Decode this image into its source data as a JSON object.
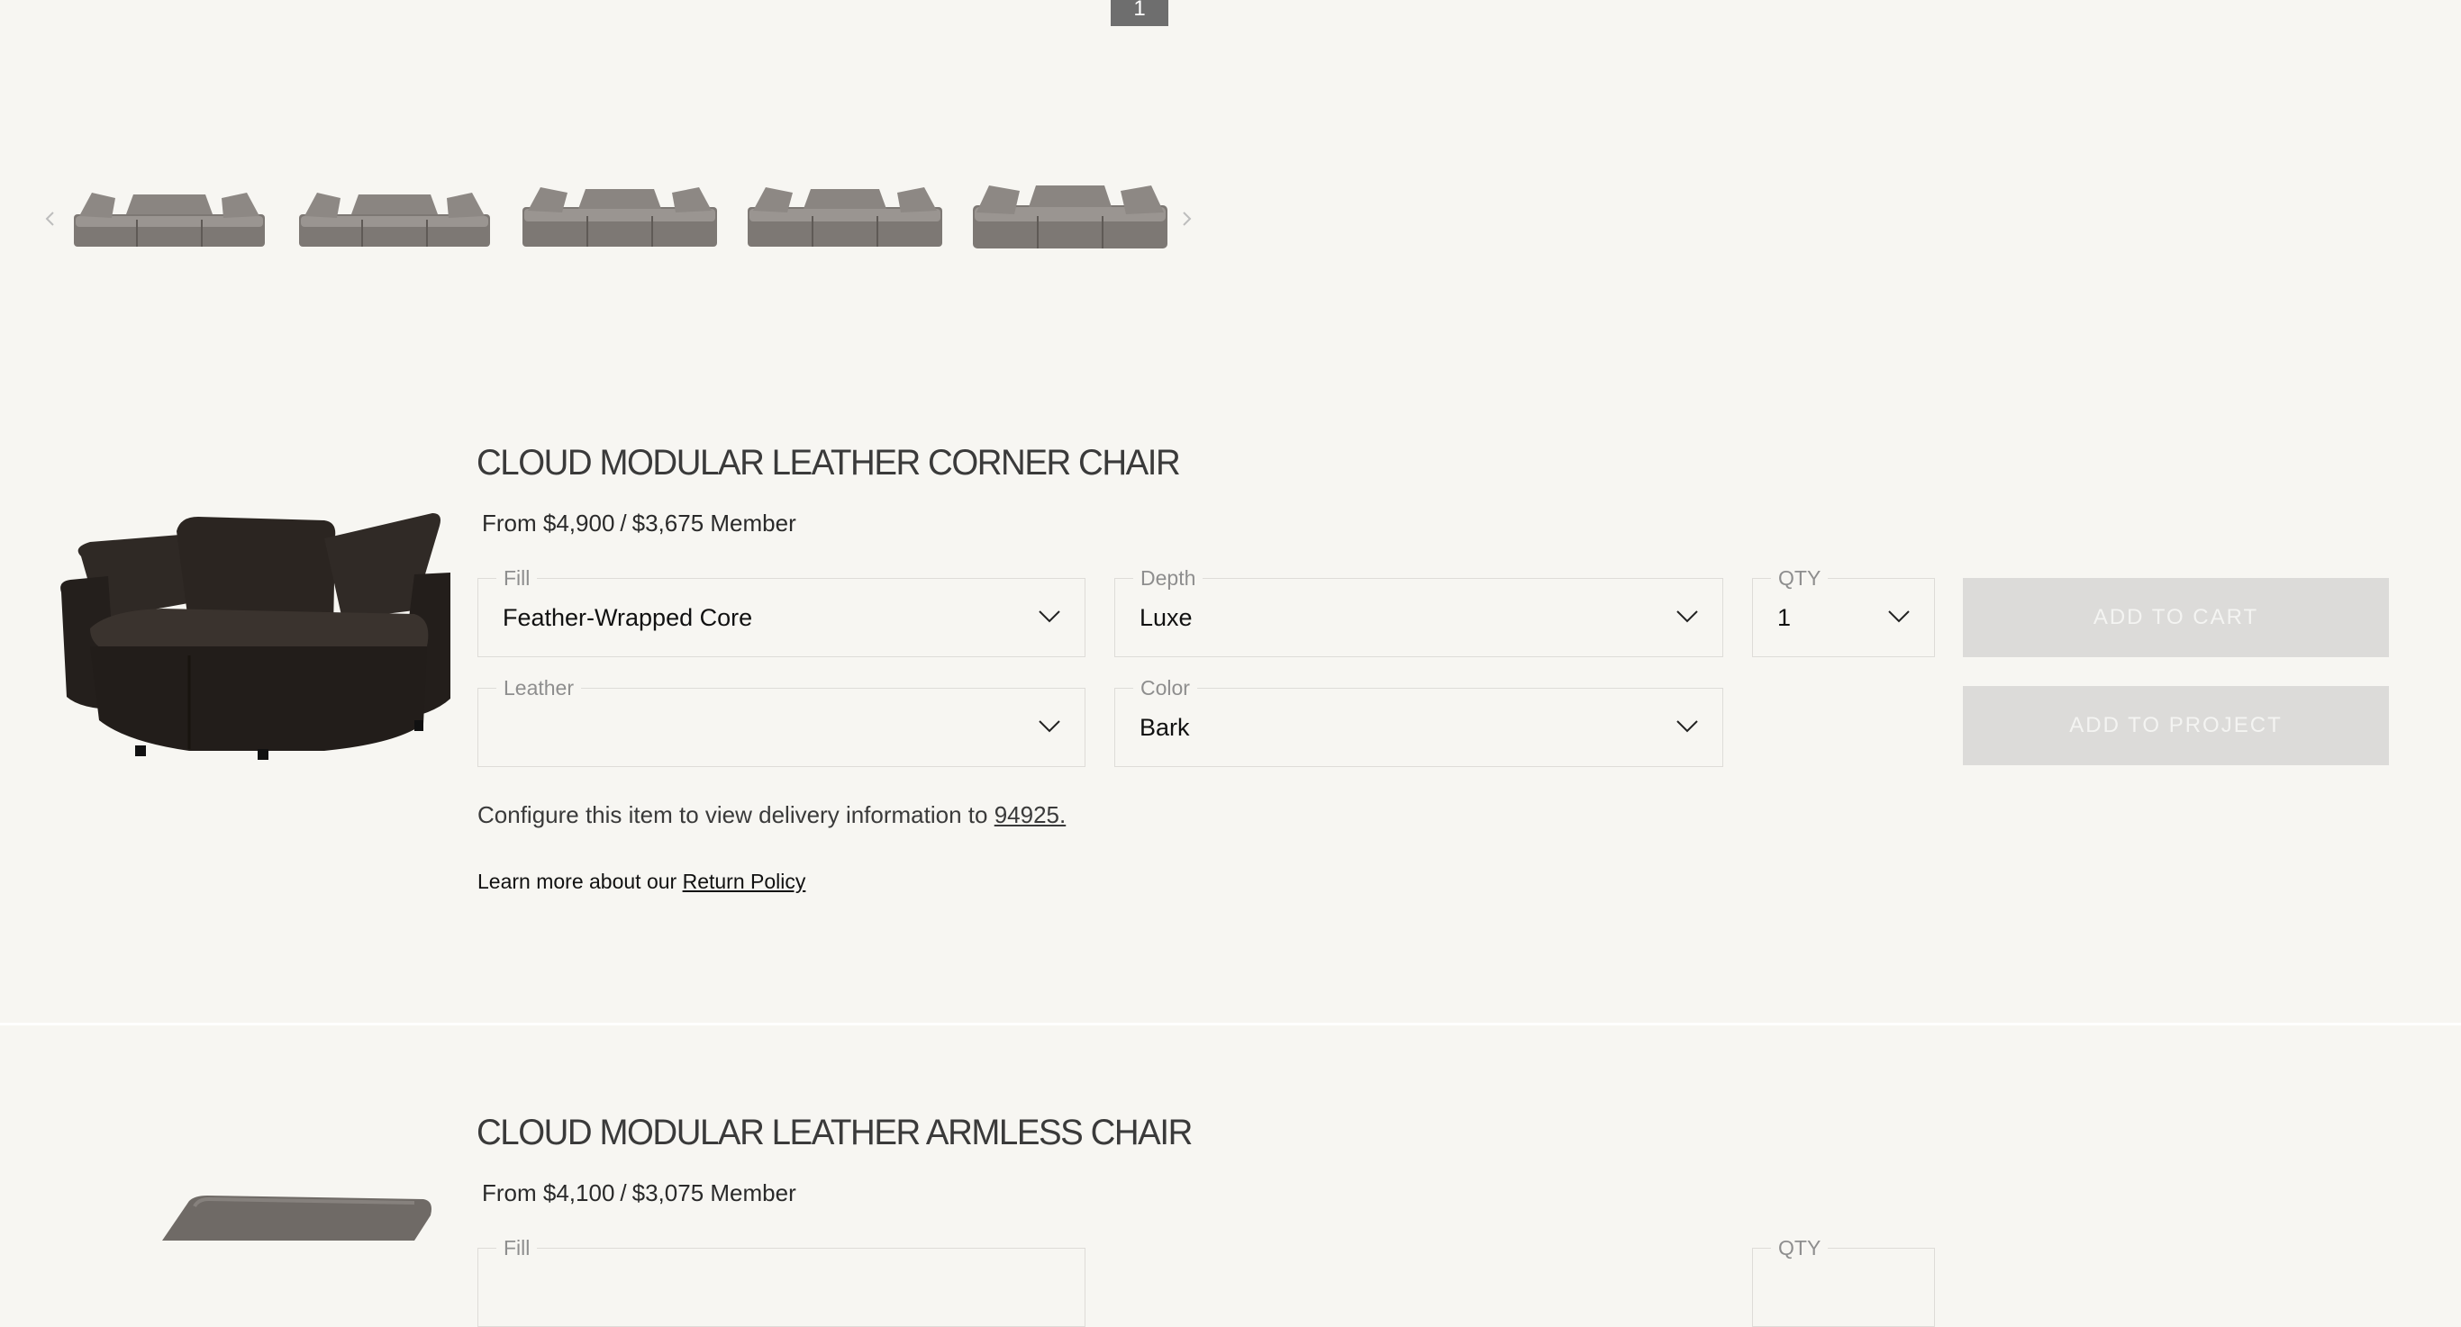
{
  "pager": {
    "current": "1"
  },
  "carousel": {
    "thumbnails": [
      "Cloud modular leather sofa configuration 1",
      "Cloud modular leather sofa configuration 2",
      "Cloud modular leather sofa configuration 3",
      "Cloud modular leather sofa configuration 4",
      "Cloud modular leather sofa configuration 5"
    ]
  },
  "product1": {
    "title": "CLOUD MODULAR LEATHER CORNER CHAIR",
    "price_regular": "From $4,900",
    "price_sep": "/",
    "price_member": "$3,675 Member",
    "fill": {
      "label": "Fill",
      "value": "Feather-Wrapped Core"
    },
    "depth": {
      "label": "Depth",
      "value": "Luxe"
    },
    "qty": {
      "label": "QTY",
      "value": "1"
    },
    "leather": {
      "label": "Leather",
      "value": ""
    },
    "color": {
      "label": "Color",
      "value": "Bark"
    },
    "add_to_cart": "ADD TO CART",
    "add_to_project": "ADD TO PROJECT",
    "delivery_text": "Configure this item to view delivery information to",
    "delivery_zip": "94925.",
    "return_text": "Learn more about our",
    "return_link": "Return Policy"
  },
  "product2": {
    "title": "CLOUD MODULAR LEATHER ARMLESS CHAIR",
    "price_regular": "From $4,100",
    "price_sep": "/",
    "price_member": "$3,075 Member",
    "fill": {
      "label": "Fill"
    },
    "qty": {
      "label": "QTY"
    }
  },
  "colors": {
    "background": "#f7f6f2",
    "button_disabled": "#dcdbd9",
    "pager": "#6e6e6e",
    "leather_dark": "#2a2420",
    "leather_grey": "#6f6a66"
  }
}
